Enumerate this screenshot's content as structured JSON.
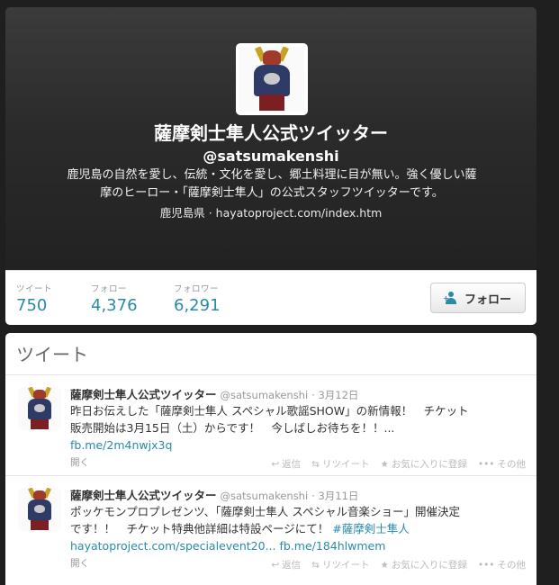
{
  "profile": {
    "name": "薩摩剣士隼人公式ツイッター",
    "handle": "@satsumakenshi",
    "bio_line1": "鹿児島の自然を愛し、伝統・文化を愛し、郷土料理に目が無い。強く優しい薩",
    "bio_line2": "摩のヒーロー・「薩摩剣士隼人」の公式スタッフツイッターです。",
    "location": "鹿児島県",
    "separator": "·",
    "url": "hayatoproject.com/index.htm"
  },
  "stats": [
    {
      "label": "ツイート",
      "value": "750"
    },
    {
      "label": "フォロー",
      "value": "4,376"
    },
    {
      "label": "フォロワー",
      "value": "6,291"
    }
  ],
  "follow_button": {
    "label": "フォロー",
    "icon": "add-person-icon"
  },
  "timeline": {
    "title": "ツイート",
    "tweets": [
      {
        "name": "薩摩剣士隼人公式ツイッター",
        "handle": "@satsumakenshi",
        "time": "· 3月12日",
        "line1": "昨日お伝えした「薩摩剣士隼人 スペシャル歌謡SHOW」の新情報！　チケット",
        "line2": "販売開始は3月15日（土）からです！　今しばしお待ちを！！...",
        "link": "fb.me/2m4nwjx3q",
        "hashtag": "",
        "open": "開く",
        "reply": "返信",
        "retweet": "リツイート",
        "favorite": "お気に入りに登録",
        "more": "その他"
      },
      {
        "name": "薩摩剣士隼人公式ツイッター",
        "handle": "@satsumakenshi",
        "time": "· 3月11日",
        "line1": "ポッケモンプロプレゼンツ、「薩摩剣士隼人 スペシャル音楽ショー」開催決定",
        "line2": "です！！　チケット特典他詳細は特設ページにて！",
        "hashtag": "#薩摩剣士隼人",
        "link": "hayatoproject.com/specialevent20...",
        "link2": "fb.me/184hlwmem",
        "open": "開く",
        "reply": "返信",
        "retweet": "リツイート",
        "favorite": "お気に入りに登録",
        "more": "その他"
      }
    ]
  },
  "colors": {
    "accent": "#2a8aa8",
    "background": "#1f1f1f",
    "header": "#2f2f2f"
  }
}
